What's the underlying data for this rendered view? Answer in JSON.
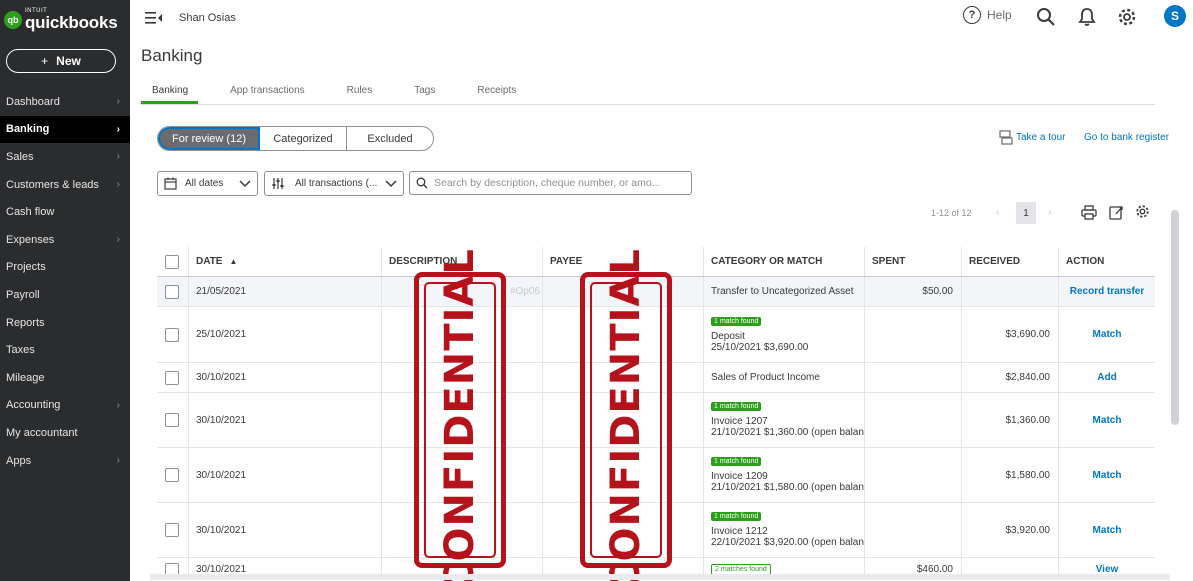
{
  "brand": {
    "intuit": "INTUIT",
    "name": "quickbooks",
    "mark": "qb",
    "color": "#2ca01c"
  },
  "sidebar": {
    "new_label": "New",
    "items": [
      {
        "label": "Dashboard",
        "chevron": true
      },
      {
        "label": "Banking",
        "chevron": true,
        "active": true
      },
      {
        "label": "Sales",
        "chevron": true
      },
      {
        "label": "Customers & leads",
        "chevron": true
      },
      {
        "label": "Cash flow",
        "chevron": false
      },
      {
        "label": "Expenses",
        "chevron": true
      },
      {
        "label": "Projects",
        "chevron": false
      },
      {
        "label": "Payroll",
        "chevron": false
      },
      {
        "label": "Reports",
        "chevron": false
      },
      {
        "label": "Taxes",
        "chevron": false
      },
      {
        "label": "Mileage",
        "chevron": false
      },
      {
        "label": "Accounting",
        "chevron": true
      },
      {
        "label": "My accountant",
        "chevron": false
      },
      {
        "label": "Apps",
        "chevron": true
      }
    ]
  },
  "header": {
    "company": "Shan Osias",
    "help_label": "Help",
    "avatar_initial": "S"
  },
  "page": {
    "title": "Banking"
  },
  "tabs": [
    {
      "label": "Banking",
      "active": true
    },
    {
      "label": "App transactions"
    },
    {
      "label": "Rules"
    },
    {
      "label": "Tags"
    },
    {
      "label": "Receipts"
    }
  ],
  "segment": [
    {
      "label": "For review (12)",
      "active": true
    },
    {
      "label": "Categorized"
    },
    {
      "label": "Excluded"
    }
  ],
  "links": {
    "tour": "Take a tour",
    "register": "Go to bank register"
  },
  "filters": {
    "dates": "All dates",
    "transactions": "All transactions (...",
    "search_placeholder": "Search by description, cheque number, or amo..."
  },
  "pager": {
    "range": "1-12 of 12",
    "current": "1"
  },
  "table": {
    "headers": {
      "date": "DATE",
      "description": "DESCRIPTION",
      "payee": "PAYEE",
      "category": "CATEGORY OR MATCH",
      "spent": "SPENT",
      "received": "RECEIVED",
      "action": "ACTION"
    },
    "rows": [
      {
        "date": "21/05/2021",
        "desc": "#Op06",
        "badge": "",
        "cat_line1": "Transfer to Uncategorized Asset",
        "cat_line2": "",
        "spent": "$50.00",
        "received": "",
        "action": "Record transfer"
      },
      {
        "date": "25/10/2021",
        "desc": "",
        "badge": "1 match found",
        "cat_line1": "Deposit",
        "cat_line2": "25/10/2021 $3,690.00",
        "spent": "",
        "received": "$3,690.00",
        "action": "Match"
      },
      {
        "date": "30/10/2021",
        "desc": "",
        "badge": "",
        "cat_line1": "Sales of Product Income",
        "cat_line2": "",
        "spent": "",
        "received": "$2,840.00",
        "action": "Add"
      },
      {
        "date": "30/10/2021",
        "desc": "",
        "badge": "1 match found",
        "cat_line1": "Invoice 1207",
        "cat_line2": "21/10/2021 $1,360.00 (open balan",
        "spent": "",
        "received": "$1,360.00",
        "action": "Match"
      },
      {
        "date": "30/10/2021",
        "desc": "",
        "badge": "1 match found",
        "cat_line1": "Invoice 1209",
        "cat_line2": "21/10/2021 $1,580.00 (open balan",
        "spent": "",
        "received": "$1,580.00",
        "action": "Match"
      },
      {
        "date": "30/10/2021",
        "desc": "",
        "badge": "1 match found",
        "cat_line1": "Invoice 1212",
        "cat_line2": "22/10/2021 $3,920.00 (open balan",
        "spent": "",
        "received": "$3,920.00",
        "action": "Match"
      },
      {
        "date": "30/10/2021",
        "desc": "",
        "badge": "2 matches found",
        "badge_outline": true,
        "cat_line1": "",
        "cat_line2": "",
        "spent": "$460.00",
        "received": "",
        "action": "View"
      }
    ]
  },
  "stamps": {
    "text": "CONFIDENTIAL",
    "color": "#b5121b"
  },
  "icons": [
    "menu-icon",
    "help-icon",
    "search-icon",
    "bell-icon",
    "gear-icon",
    "calendar-icon",
    "filter-icon",
    "print-icon",
    "export-icon",
    "settings-icon",
    "chevron-down-icon",
    "tour-icon"
  ]
}
